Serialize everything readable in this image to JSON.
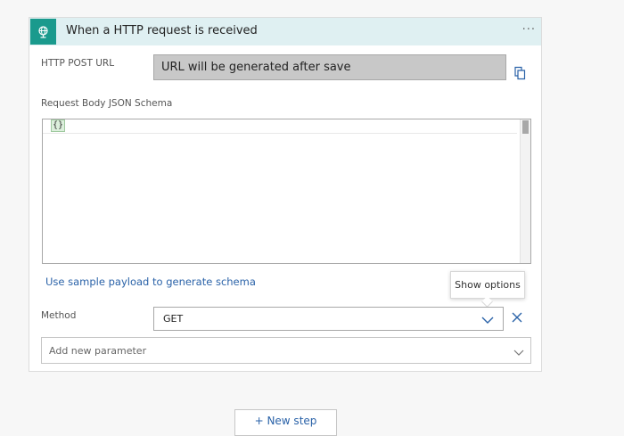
{
  "trigger": {
    "title": "When a HTTP request is received",
    "more_label": "···",
    "icon": "http-request-icon",
    "accent_color": "#1a9a8d",
    "header_color": "#dff0f2"
  },
  "http_post_url": {
    "label": "HTTP POST URL",
    "value": "URL will be generated after save",
    "copy_icon": "copy-icon"
  },
  "schema": {
    "label": "Request Body JSON Schema",
    "content": "{}",
    "sample_link": "Use sample payload to generate schema"
  },
  "method": {
    "label": "Method",
    "value": "GET",
    "tooltip": "Show options",
    "chevron_icon": "chevron-down-icon",
    "remove_icon": "close-icon"
  },
  "parameter": {
    "placeholder": "Add new parameter",
    "chevron_icon": "chevron-down-icon"
  },
  "new_step": {
    "label": "+ New step"
  },
  "colors": {
    "link": "#2a62a8",
    "url_box": "#c8c8c8"
  }
}
